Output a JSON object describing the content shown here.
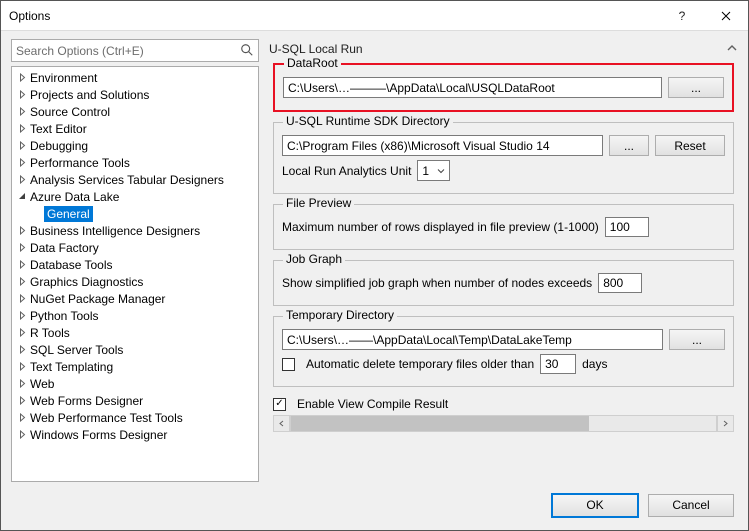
{
  "window": {
    "title": "Options"
  },
  "search": {
    "placeholder": "Search Options (Ctrl+E)"
  },
  "tree": {
    "items": [
      {
        "label": "Environment",
        "expanded": false,
        "level": 0
      },
      {
        "label": "Projects and Solutions",
        "expanded": false,
        "level": 0
      },
      {
        "label": "Source Control",
        "expanded": false,
        "level": 0
      },
      {
        "label": "Text Editor",
        "expanded": false,
        "level": 0
      },
      {
        "label": "Debugging",
        "expanded": false,
        "level": 0
      },
      {
        "label": "Performance Tools",
        "expanded": false,
        "level": 0
      },
      {
        "label": "Analysis Services Tabular Designers",
        "expanded": false,
        "level": 0
      },
      {
        "label": "Azure Data Lake",
        "expanded": true,
        "level": 0
      },
      {
        "label": "General",
        "expanded": false,
        "level": 1,
        "selected": true
      },
      {
        "label": "Business Intelligence Designers",
        "expanded": false,
        "level": 0
      },
      {
        "label": "Data Factory",
        "expanded": false,
        "level": 0
      },
      {
        "label": "Database Tools",
        "expanded": false,
        "level": 0
      },
      {
        "label": "Graphics Diagnostics",
        "expanded": false,
        "level": 0
      },
      {
        "label": "NuGet Package Manager",
        "expanded": false,
        "level": 0
      },
      {
        "label": "Python Tools",
        "expanded": false,
        "level": 0
      },
      {
        "label": "R Tools",
        "expanded": false,
        "level": 0
      },
      {
        "label": "SQL Server Tools",
        "expanded": false,
        "level": 0
      },
      {
        "label": "Text Templating",
        "expanded": false,
        "level": 0
      },
      {
        "label": "Web",
        "expanded": false,
        "level": 0
      },
      {
        "label": "Web Forms Designer",
        "expanded": false,
        "level": 0
      },
      {
        "label": "Web Performance Test Tools",
        "expanded": false,
        "level": 0
      },
      {
        "label": "Windows Forms Designer",
        "expanded": false,
        "level": 0
      }
    ]
  },
  "panel": {
    "heading": "U-SQL Local Run",
    "dataroot": {
      "legend": "DataRoot",
      "value": "C:\\Users\\…———\\AppData\\Local\\USQLDataRoot",
      "browse": "..."
    },
    "runtime": {
      "legend": "U-SQL Runtime SDK Directory",
      "value": "C:\\Program Files (x86)\\Microsoft Visual Studio 14",
      "browse": "...",
      "reset": "Reset",
      "analytics_label": "Local Run Analytics Unit",
      "analytics_value": "1"
    },
    "filepreview": {
      "legend": "File Preview",
      "label": "Maximum number of rows displayed in file preview (1-1000)",
      "value": "100"
    },
    "jobgraph": {
      "legend": "Job Graph",
      "label": "Show simplified job graph when number of nodes exceeds",
      "value": "800"
    },
    "tempdir": {
      "legend": "Temporary Directory",
      "value": "C:\\Users\\…——\\AppData\\Local\\Temp\\DataLakeTemp",
      "browse": "...",
      "auto_label_pre": "Automatic delete temporary files older than",
      "auto_days": "30",
      "auto_label_post": "days",
      "auto_checked": false
    },
    "enable_compile": {
      "label": "Enable View Compile Result",
      "checked": true
    }
  },
  "footer": {
    "ok": "OK",
    "cancel": "Cancel"
  }
}
